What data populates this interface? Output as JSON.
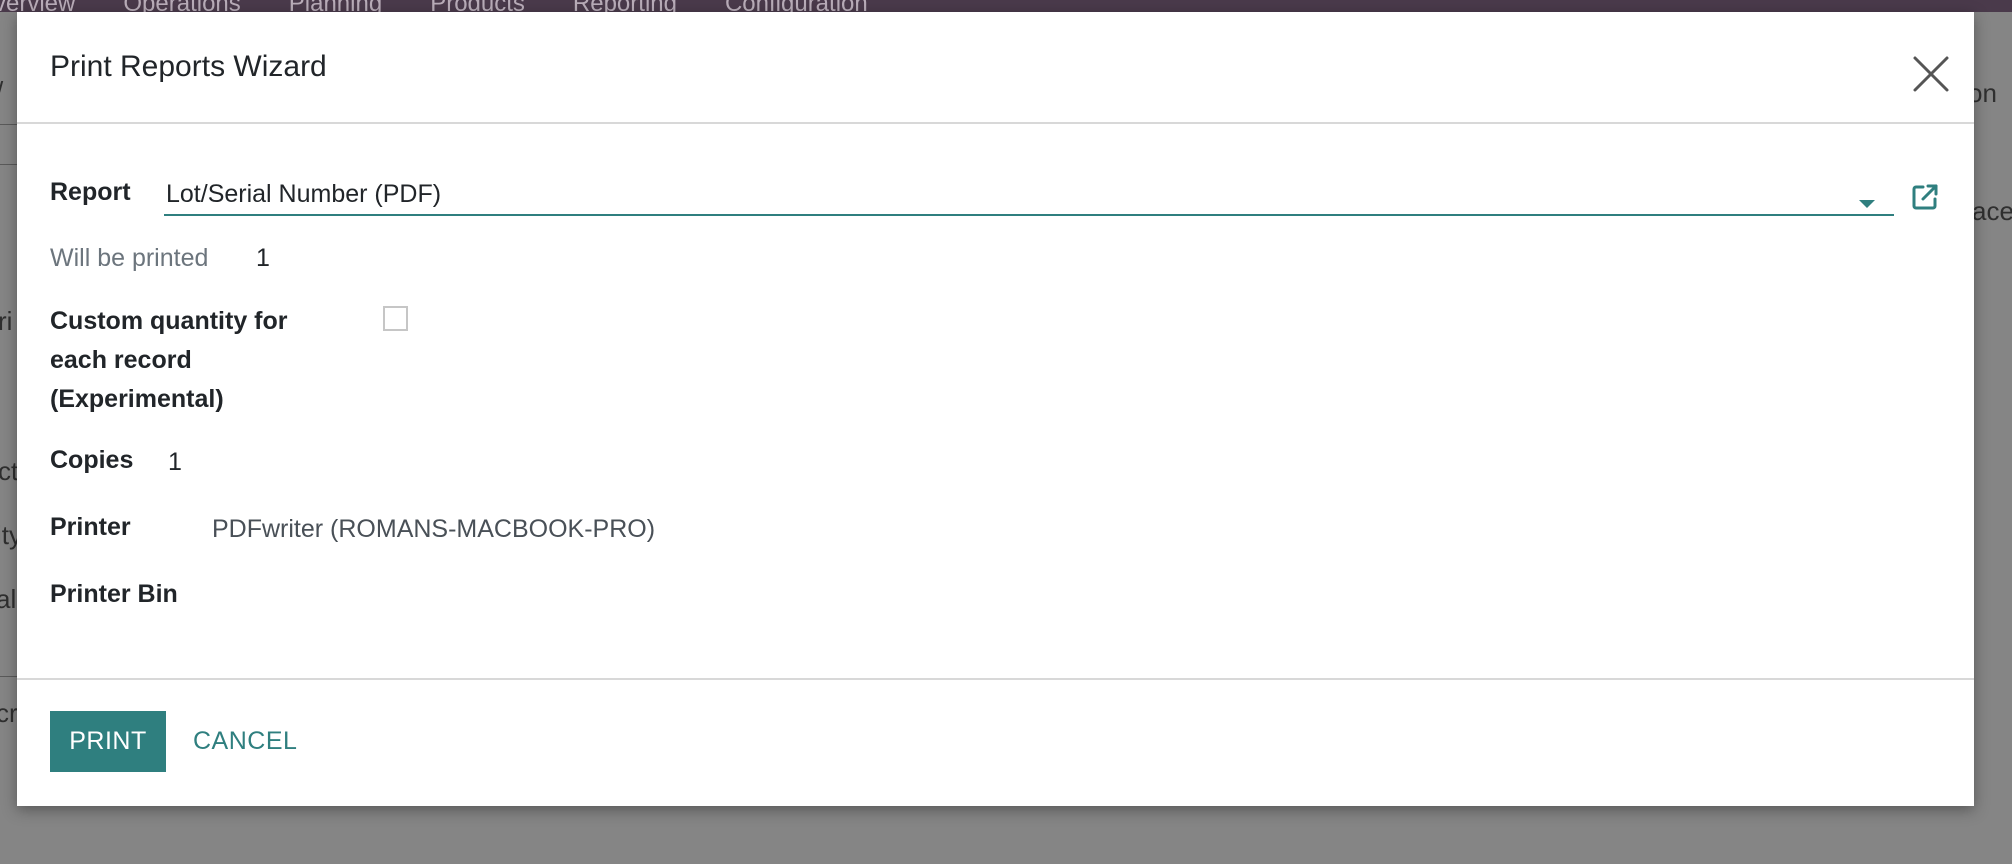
{
  "background_app": {
    "menu": [
      "verview",
      "Operations",
      "Planning",
      "Products",
      "Reporting",
      "Configuration"
    ],
    "fragments": [
      "on",
      "ace",
      "ri",
      "ct",
      "ity",
      "al",
      "cr",
      "/"
    ]
  },
  "dialog": {
    "title": "Print Reports Wizard",
    "close_icon": "close-icon"
  },
  "form": {
    "report": {
      "label": "Report",
      "value": "Lot/Serial Number (PDF)",
      "dropdown_icon": "caret-down-icon",
      "open_icon": "external-link-icon"
    },
    "will_be_printed": {
      "label": "Will be printed",
      "value": "1"
    },
    "custom_quantity": {
      "label_lines": [
        "Custom quantity for",
        "each record",
        "(Experimental)"
      ],
      "checked": false
    },
    "copies": {
      "label": "Copies",
      "value": "1"
    },
    "printer": {
      "label": "Printer",
      "value": "PDFwriter (ROMANS-MACBOOK-PRO)"
    },
    "printer_bin": {
      "label": "Printer Bin",
      "value": ""
    }
  },
  "footer": {
    "print_label": "PRINT",
    "cancel_label": "CANCEL"
  },
  "colors": {
    "accent": "#2f7f7f",
    "navbar": "#4a3a4b",
    "backdrop": "#7e7e7e"
  }
}
